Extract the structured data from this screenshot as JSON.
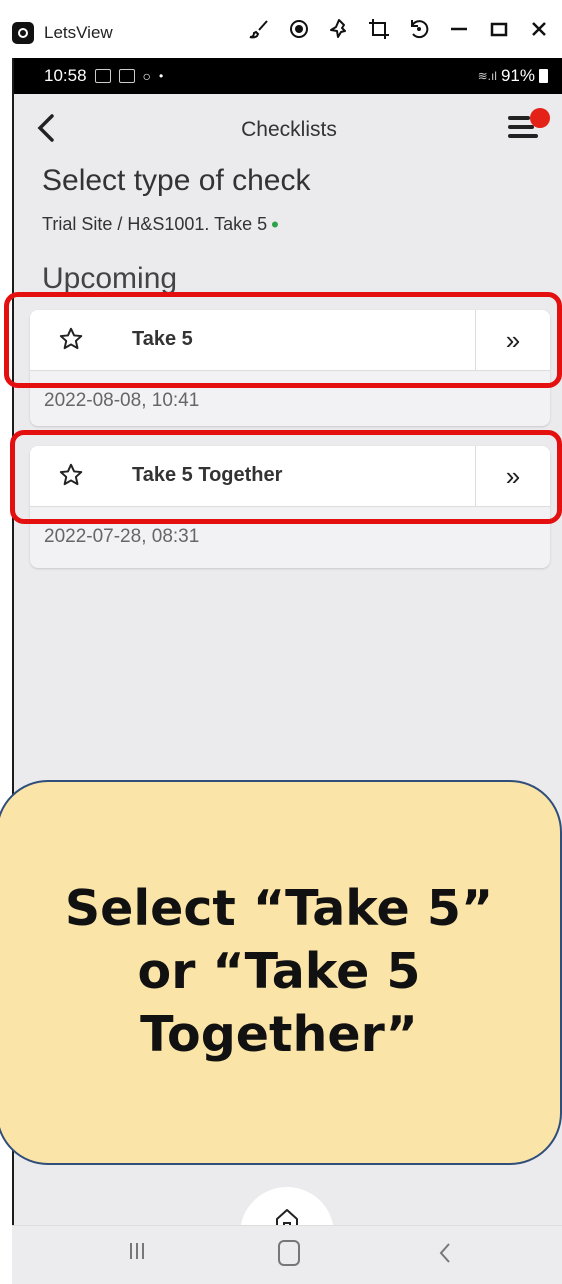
{
  "window": {
    "app_name": "LetsView",
    "icons": [
      "brush-icon",
      "record-icon",
      "pin-icon",
      "crop-icon",
      "rotate-icon",
      "minimize-icon",
      "maximize-icon",
      "close-icon"
    ]
  },
  "statusbar": {
    "time": "10:58",
    "battery": "91%"
  },
  "header": {
    "title": "Checklists"
  },
  "page": {
    "title": "Select type of check",
    "breadcrumb": "Trial Site / H&S1001. Take 5",
    "breadcrumb_dot": "•",
    "section": "Upcoming"
  },
  "cards": [
    {
      "title": "Take 5",
      "date": "2022-08-08, 10:41",
      "go": "»"
    },
    {
      "title": "Take 5 Together",
      "date": "2022-07-28, 08:31",
      "go": "»"
    }
  ],
  "callout": {
    "text": "Select “Take 5” or “Take 5 Together”"
  },
  "colors": {
    "highlight": "#e41010",
    "callout_bg": "#fae4a8",
    "notification": "#e42218",
    "status_ok": "#2ca24a"
  }
}
